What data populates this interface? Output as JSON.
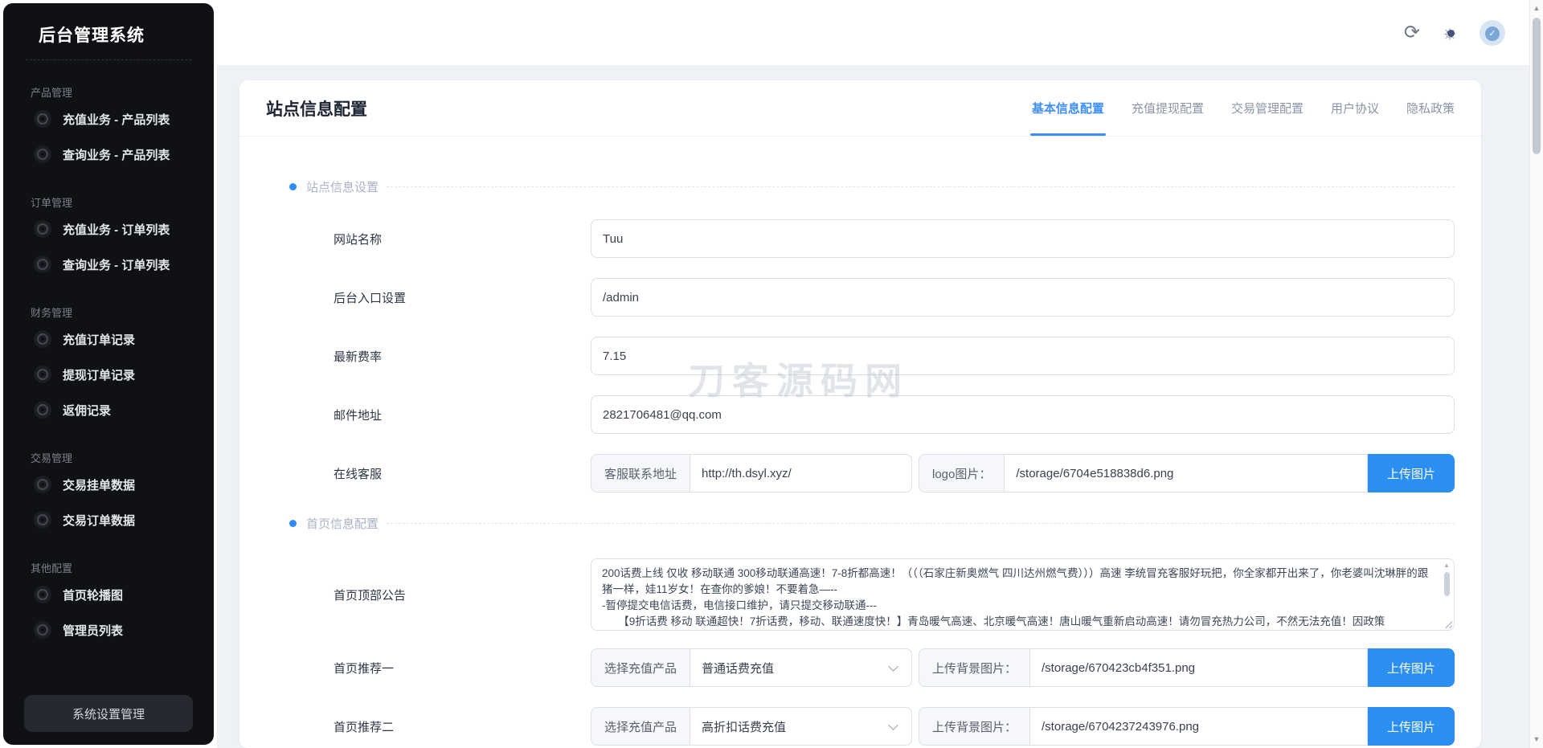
{
  "colors": {
    "accent": "#3e8ef7",
    "upload_button": "#2b8ff2",
    "sidebar_bg": "#0f1115"
  },
  "sidebar": {
    "title": "后台管理系统",
    "groups": [
      {
        "label": "产品管理",
        "items": [
          "充值业务 - 产品列表",
          "查询业务 - 产品列表"
        ]
      },
      {
        "label": "订单管理",
        "items": [
          "充值业务 - 订单列表",
          "查询业务 - 订单列表"
        ]
      },
      {
        "label": "财务管理",
        "items": [
          "充值订单记录",
          "提现订单记录",
          "返佣记录"
        ]
      },
      {
        "label": "交易管理",
        "items": [
          "交易挂单数据",
          "交易订单数据"
        ]
      },
      {
        "label": "其他配置",
        "items": [
          "首页轮播图",
          "管理员列表"
        ]
      }
    ],
    "system_button": "系统设置管理"
  },
  "topbar": {
    "icons": [
      "refresh-icon",
      "theme-toggle-icon",
      "avatar"
    ]
  },
  "page": {
    "title": "站点信息配置",
    "tabs": [
      {
        "label": "基本信息配置",
        "active": true
      },
      {
        "label": "充值提现配置",
        "active": false
      },
      {
        "label": "交易管理配置",
        "active": false
      },
      {
        "label": "用户协议",
        "active": false
      },
      {
        "label": "隐私政策",
        "active": false
      }
    ]
  },
  "sections": {
    "site": "站点信息设置",
    "home": "首页信息配置"
  },
  "form": {
    "website_name": {
      "label": "网站名称",
      "value": "Tuu"
    },
    "admin_entry": {
      "label": "后台入口设置",
      "value": "/admin"
    },
    "latest_rate": {
      "label": "最新费率",
      "value": "7.15"
    },
    "email": {
      "label": "邮件地址",
      "value": "2821706481@qq.com"
    },
    "online_service": {
      "label": "在线客服",
      "url_addon": "客服联系地址",
      "url_value": "http://th.dsyl.xyz/",
      "logo_addon": "logo图片：",
      "logo_value": "/storage/6704e518838d6.png",
      "upload_label": "上传图片"
    },
    "announcement": {
      "label": "首页顶部公告",
      "value": "200话费上线 仅收 移动联通 300移动联通高速！7-8折都高速！（（（石家庄新奥燃气 四川达州燃气费）））高速 李统冒充客服好玩把，你全家都开出来了，你老婆叫沈琳胖的跟猪一样，娃11岁女！在查你的爹娘！不要着急—--\n-暂停提交电信话费，电信接口维护，请只提交移动联通---\n　　【9折话费 移动 联通超快！7折话费，移动、联通速度快！】青岛暖气高速、北京暖气高速！唐山暖气重新启动高速！请勿冒充热力公司，不然无法充值！因政策"
    },
    "recommend1": {
      "label": "首页推荐一",
      "select_addon": "选择充值产品",
      "selected": "普通话费充值",
      "bg_addon": "上传背景图片：",
      "bg_value": "/storage/670423cb4f351.png",
      "upload_label": "上传图片"
    },
    "recommend2": {
      "label": "首页推荐二",
      "select_addon": "选择充值产品",
      "selected": "高折扣话费充值",
      "bg_addon": "上传背景图片：",
      "bg_value": "/storage/6704237243976.png",
      "upload_label": "上传图片"
    }
  },
  "watermark": "刀客源码网"
}
